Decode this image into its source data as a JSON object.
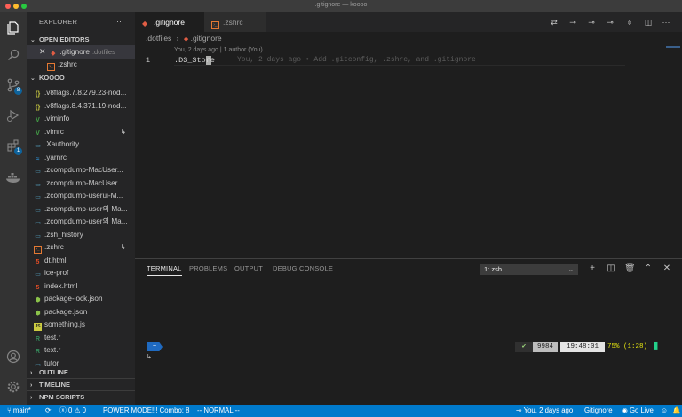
{
  "window": {
    "title": ".gitignore — koooo"
  },
  "colors": {
    "accent": "#007acc",
    "badge": "#0e639c",
    "git": "#e2c08d",
    "green_mark": "#23d18b"
  },
  "activity": {
    "icons": [
      "explorer-icon",
      "search-icon",
      "source-control-icon",
      "run-debug-icon",
      "extensions-icon",
      "docker-icon",
      "account-icon",
      "settings-gear-icon"
    ],
    "source_control_badge": "8",
    "extensions_badge": "1"
  },
  "sidebar": {
    "title": "EXPLORER",
    "more": "···",
    "open_editors": {
      "label": "OPEN EDITORS",
      "items": [
        {
          "name": ".gitignore",
          "detail": ".dotfiles"
        },
        {
          "name": ".zshrc",
          "detail": ""
        }
      ]
    },
    "folder": {
      "label": "KOOOO",
      "items": [
        {
          "name": ".v8flags.7.8.279.23-nod...",
          "icon": "json-icon",
          "glyph": "{}",
          "color": "#cbcb41",
          "git": false
        },
        {
          "name": ".v8flags.8.4.371.19-nod...",
          "icon": "json-icon",
          "glyph": "{}",
          "color": "#cbcb41",
          "git": false
        },
        {
          "name": ".viminfo",
          "icon": "vim-icon",
          "glyph": "V",
          "color": "#43a047",
          "git": false
        },
        {
          "name": ".vimrc",
          "icon": "vim-icon",
          "glyph": "V",
          "color": "#43a047",
          "git": true
        },
        {
          "name": ".Xauthority",
          "icon": "file-icon",
          "glyph": "▭",
          "color": "#519aba",
          "git": false
        },
        {
          "name": ".yarnrc",
          "icon": "yarn-icon",
          "glyph": "≈",
          "color": "#2f87c3",
          "git": false
        },
        {
          "name": ".zcompdump-MacUser...",
          "icon": "file-icon",
          "glyph": "▭",
          "color": "#519aba",
          "git": false
        },
        {
          "name": ".zcompdump-MacUser...",
          "icon": "file-icon",
          "glyph": "▭",
          "color": "#519aba",
          "git": false
        },
        {
          "name": ".zcompdump-userui-M...",
          "icon": "file-icon",
          "glyph": "▭",
          "color": "#519aba",
          "git": false
        },
        {
          "name": ".zcompdump-user의 Ma...",
          "icon": "file-icon",
          "glyph": "▭",
          "color": "#519aba",
          "git": false
        },
        {
          "name": ".zcompdump-user의 Ma...",
          "icon": "file-icon",
          "glyph": "▭",
          "color": "#519aba",
          "git": false
        },
        {
          "name": ".zsh_history",
          "icon": "file-icon",
          "glyph": "▭",
          "color": "#519aba",
          "git": false
        },
        {
          "name": ".zshrc",
          "icon": "shell-icon",
          "glyph": "›_",
          "color": "#e37933",
          "git": true
        },
        {
          "name": "dt.html",
          "icon": "html-icon",
          "glyph": "5",
          "color": "#e44d26",
          "git": false
        },
        {
          "name": "ice-prof",
          "icon": "file-icon",
          "glyph": "▭",
          "color": "#519aba",
          "git": false
        },
        {
          "name": "index.html",
          "icon": "html-icon",
          "glyph": "5",
          "color": "#e44d26",
          "git": false
        },
        {
          "name": "package-lock.json",
          "icon": "npm-icon",
          "glyph": "⬢",
          "color": "#8bc34a",
          "git": false
        },
        {
          "name": "package.json",
          "icon": "npm-icon",
          "glyph": "⬢",
          "color": "#8bc34a",
          "git": false
        },
        {
          "name": "something.js",
          "icon": "js-icon",
          "glyph": "JS",
          "color": "#cbcb41",
          "git": false
        },
        {
          "name": "test.r",
          "icon": "r-icon",
          "glyph": "R",
          "color": "#358a5b",
          "git": false
        },
        {
          "name": "text.r",
          "icon": "r-icon",
          "glyph": "R",
          "color": "#358a5b",
          "git": false
        },
        {
          "name": "tutor",
          "icon": "file-icon",
          "glyph": "▭",
          "color": "#519aba",
          "git": false
        }
      ]
    },
    "outline": "OUTLINE",
    "timeline": "TIMELINE",
    "npm_scripts": "NPM SCRIPTS"
  },
  "editor": {
    "tabs": [
      {
        "name": ".gitignore"
      },
      {
        "name": ".zshrc"
      }
    ],
    "breadcrumb": {
      "folder": ".dotfiles",
      "file": ".gitignore"
    },
    "codelens": "You, 2 days ago | 1 author (You)",
    "line_number": "1",
    "code": ".DS_Store",
    "inline_blame": "You, 2 days ago • Add .gitconfig, .zshrc, and .gitignore"
  },
  "panel": {
    "tabs": [
      "TERMINAL",
      "PROBLEMS",
      "OUTPUT",
      "DEBUG CONSOLE"
    ],
    "terminal_select": "1: zsh",
    "prompt_badge": "~",
    "prompt_sub": "↳",
    "right_prompt": {
      "check": "✔",
      "count": "9984",
      "time": "19:48:01",
      "battery": "75% (1:28)",
      "battery_block": "▊"
    }
  },
  "statusbar": {
    "branch": "main*",
    "sync": "⟳",
    "errors": "0",
    "warnings": "0",
    "power_mode": "POWER MODE!!! Combo: 8",
    "vim_mode": "-- NORMAL --",
    "blame": "You, 2 days ago",
    "language": "Gitignore",
    "go_live": "Go Live"
  }
}
